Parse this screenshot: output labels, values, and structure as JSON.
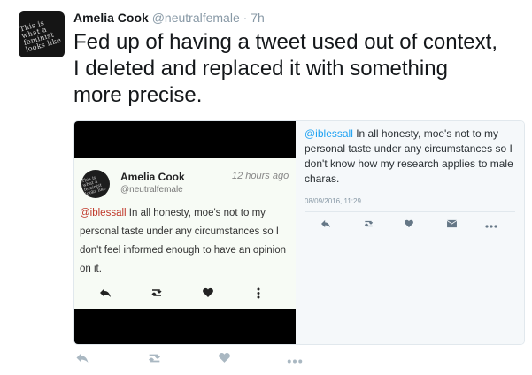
{
  "tweet": {
    "avatar_scribble": "This is what a feminist looks like",
    "fullname": "Amelia Cook",
    "username": "@neutralfemale",
    "dot": "·",
    "time": "7h",
    "text": "Fed up of having a tweet used out of context, I deleted and replaced it with something more precise."
  },
  "screenshot": {
    "name": "Amelia Cook",
    "username": "@neutralfemale",
    "time": "12 hours ago",
    "mention": "@iblessall",
    "text": " In all honesty, moe's not to my personal taste under any circumstances so I don't feel informed enough to have an opinion on it.",
    "icons": [
      "reply-icon",
      "retweet-icon",
      "heart-icon",
      "more-vertical-icon"
    ]
  },
  "quoted": {
    "mention": "@iblessall",
    "text": " In all honesty, moe's not to my personal taste under any circumstances so I don't know how my research applies to male charas.",
    "date": "08/09/2016, 11:29",
    "icons": [
      "reply-icon",
      "retweet-icon",
      "heart-icon",
      "dm-icon",
      "more-icon"
    ]
  },
  "actions": {
    "icons": [
      "reply-icon",
      "retweet-icon",
      "heart-icon",
      "more-icon"
    ]
  }
}
